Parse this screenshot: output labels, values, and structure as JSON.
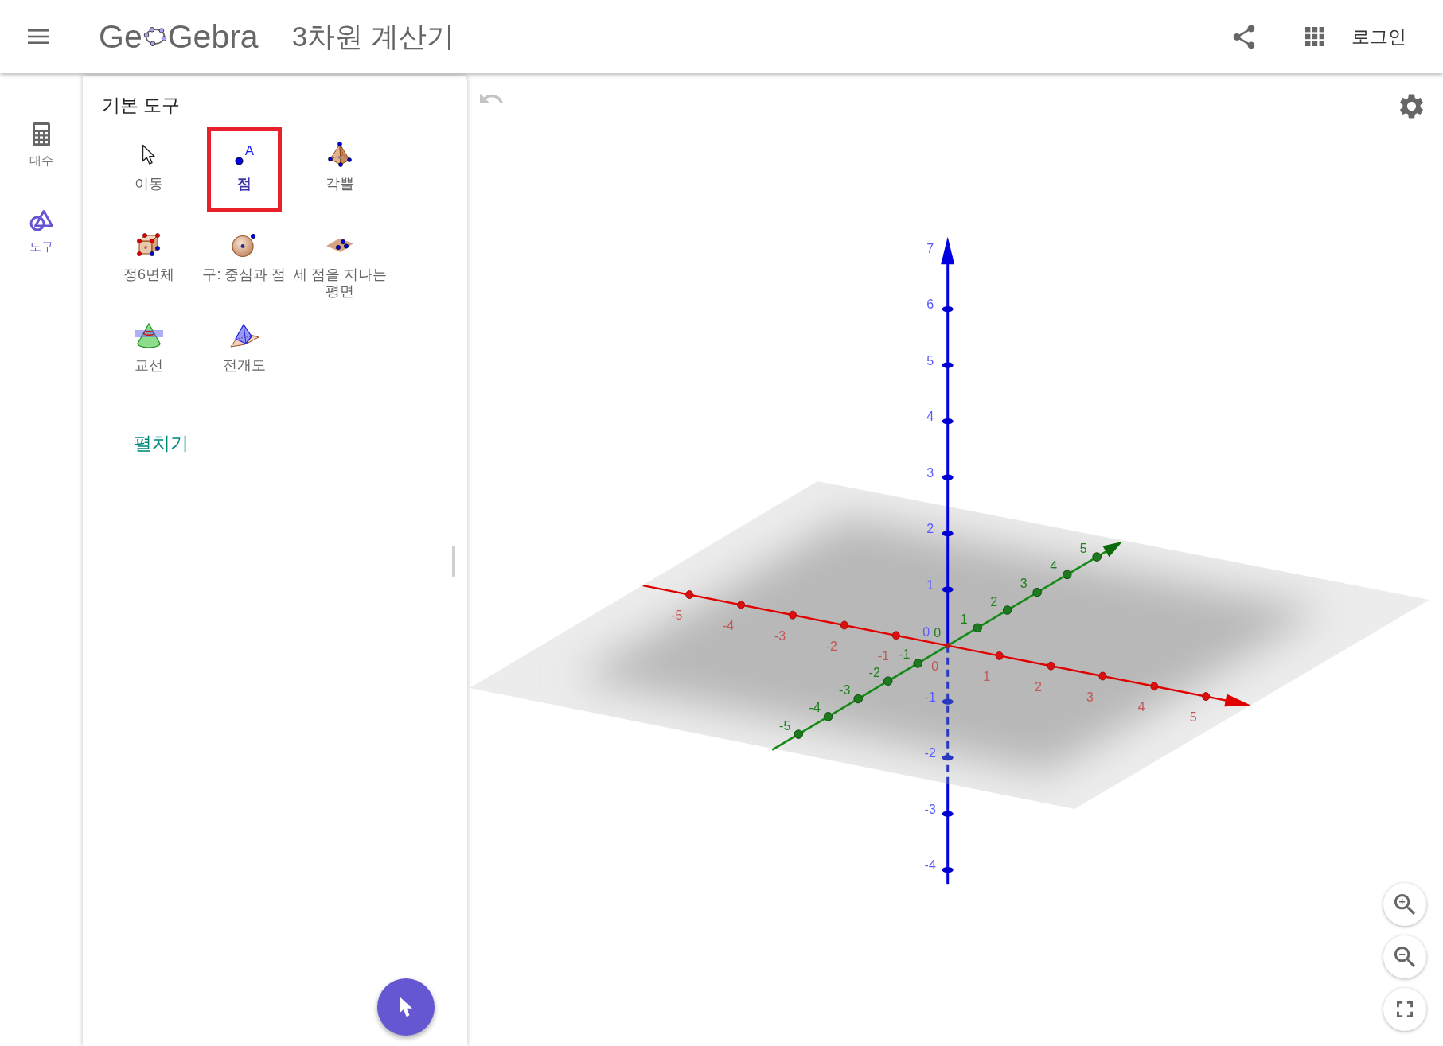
{
  "header": {
    "logo_text": [
      "Ge",
      "Gebra"
    ],
    "title": "3차원 계산기",
    "login": "로그인"
  },
  "sidebar": {
    "items": [
      {
        "label": "대수",
        "selected": false
      },
      {
        "label": "도구",
        "selected": true
      }
    ]
  },
  "tools_panel": {
    "heading": "기본 도구",
    "tools": [
      {
        "label": "이동",
        "selected": false
      },
      {
        "label": "점",
        "selected": true,
        "icon_text": "A"
      },
      {
        "label": "각뿔",
        "selected": false
      },
      {
        "label": "정6면체",
        "selected": false
      },
      {
        "label": "구: 중심과 점",
        "selected": false
      },
      {
        "label": "세 점을 지나는 평면",
        "selected": false
      },
      {
        "label": "교선",
        "selected": false
      },
      {
        "label": "전개도",
        "selected": false
      }
    ],
    "expand_link": "펼치기"
  },
  "graphics_view": {
    "undo": {
      "disabled": true
    },
    "z_axis": {
      "labels": [
        "7",
        "6",
        "5",
        "4",
        "3",
        "2",
        "1",
        "0",
        "-1",
        "-2",
        "-3",
        "-4"
      ]
    },
    "x_axis": {
      "labels": [
        "-5",
        "-4",
        "-3",
        "-2",
        "-1",
        "0",
        "1",
        "2",
        "3",
        "4",
        "5"
      ]
    },
    "y_axis": {
      "labels": [
        "-5",
        "-4",
        "-3",
        "-2",
        "-1",
        "0",
        "1",
        "2",
        "3",
        "4",
        "5"
      ]
    }
  }
}
